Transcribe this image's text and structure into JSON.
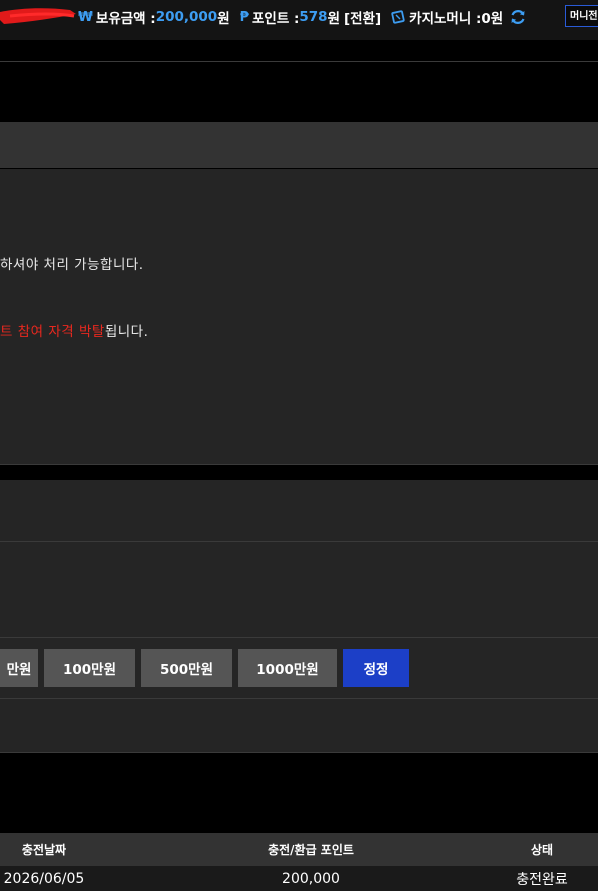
{
  "topbar": {
    "balance_symbol": "₩",
    "balance_label": "보유금액 : ",
    "balance_value": "200,000",
    "balance_unit": "원",
    "point_symbol": "₱",
    "point_label": "포인트 : ",
    "point_value": "578",
    "point_unit": "원",
    "point_convert": "[전환]",
    "casino_label": "카지노머니 : ",
    "casino_value": "0원",
    "money_button": "머니전"
  },
  "notice": {
    "line1": "하셔야 처리 가능합니다.",
    "line2_red": "트 참여 자격 박탈",
    "line2_rest": "됩니다."
  },
  "amount_buttons": {
    "partial": "만원",
    "b100": "100만원",
    "b500": "500만원",
    "b1000": "1000만원",
    "correct": "정정"
  },
  "table": {
    "headers": [
      "충전날짜",
      "충전/환급 포인트",
      "상태"
    ],
    "rows": [
      {
        "date": "2026/06/05",
        "points": "200,000",
        "status": "충전완료"
      }
    ]
  },
  "colors": {
    "accent_blue": "#3d9df2",
    "button_blue": "#1c3fc7",
    "warning_red": "#e8281f"
  }
}
